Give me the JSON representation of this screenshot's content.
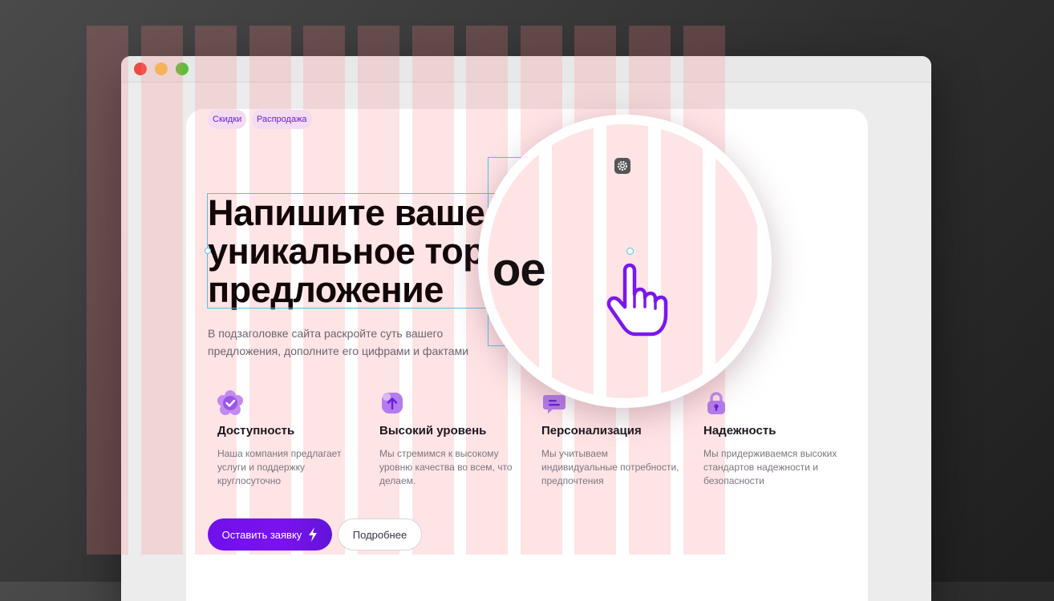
{
  "window": {
    "controls": [
      "close",
      "minimize",
      "maximize"
    ]
  },
  "chips": [
    "Скидки",
    "Распродажа"
  ],
  "hero": {
    "title_lines": [
      "Напишите ваше",
      "уникальное торговое",
      "предложение"
    ],
    "subtitle_lines": [
      "В подзаголовке сайта раскройте суть вашего",
      "предложения, дополните его цифрами и фактами"
    ]
  },
  "magnifier": {
    "zoom_text": "ое",
    "settings_icon": "gear-icon",
    "cursor_icon": "hand-pointer-icon"
  },
  "features": [
    {
      "icon": "flower-check-icon",
      "title": "Доступность",
      "text": "Наша компания предлагает услуги и поддержку круглосуточно"
    },
    {
      "icon": "arrow-up-icon",
      "title": "Высокий уровень",
      "text": "Мы стремимся к высокому уровню качества во всем, что делаем."
    },
    {
      "icon": "chat-icon",
      "title": "Персонализация",
      "text": "Мы учитываем индивидуальные потребности, предпочтения"
    },
    {
      "icon": "lock-icon",
      "title": "Надежность",
      "text": "Мы придерживаемся высоких стандартов надежности и безопасности"
    }
  ],
  "buttons": {
    "primary": "Оставить заявку",
    "primary_icon": "lightning-icon",
    "secondary": "Подробнее"
  },
  "colors": {
    "accent": "#7010ec",
    "grid": "#ffd7d9",
    "selection": "#4fc4e8"
  }
}
